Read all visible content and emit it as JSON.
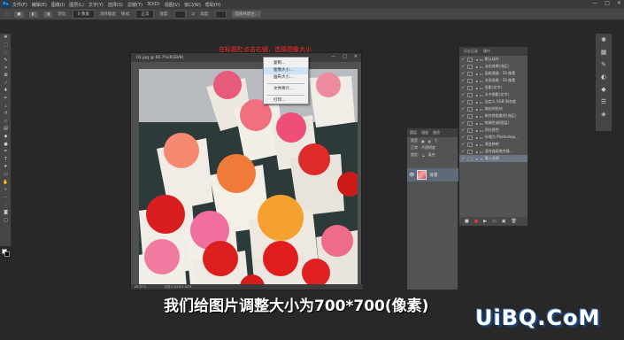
{
  "app": {
    "logo": "Ps"
  },
  "menubar": {
    "items": [
      "文件(F)",
      "编辑(E)",
      "图像(I)",
      "图层(L)",
      "文字(Y)",
      "选择(S)",
      "滤镜(T)",
      "3D(D)",
      "视图(V)",
      "窗口(W)",
      "帮助(H)"
    ]
  },
  "window_controls": {
    "minimize": "—",
    "maximize": "□",
    "close": "✕"
  },
  "options_bar": {
    "feather_label": "羽化:",
    "feather_value": "0 像素",
    "antialias": "消除锯齿",
    "style_label": "样式:",
    "style_value": "正常",
    "width_label": "宽度:",
    "height_label": "高度:",
    "select_mask": "选择并遮住..."
  },
  "document": {
    "title": "01.jpg @ 66.7%(RGB/8)",
    "zoom": "66.67%",
    "docinfo": "文档:1.82M/1.82M"
  },
  "context_menu": {
    "items": [
      "复制...",
      "图像大小...",
      "画布大小...",
      "文件简介...",
      "打印..."
    ]
  },
  "caption": {
    "text": "在标题栏点击右键，选择图像大小"
  },
  "layers_panel": {
    "tabs": [
      "图层",
      "通道",
      "路径"
    ],
    "filter": "类型",
    "mode": "正常",
    "opacity": "不透明度",
    "lock": "锁定:",
    "fill": "填充",
    "layer_name": "背景"
  },
  "history_panel": {
    "tabs": [
      "历史记录",
      "操作"
    ],
    "items": [
      {
        "label": "默认动作",
        "expand": "▾"
      },
      {
        "label": "淡出效果(选区)",
        "expand": "▸"
      },
      {
        "label": "画框通道 - 50 像素",
        "expand": "▸"
      },
      {
        "label": "木质画框 - 50 像素",
        "expand": "▸"
      },
      {
        "label": "投影(文字)",
        "expand": "▸"
      },
      {
        "label": "水中倒影(文字)",
        "expand": "▸"
      },
      {
        "label": "自定义 RGB 到灰度",
        "expand": "▸"
      },
      {
        "label": "熔化的铅块",
        "expand": "▸"
      },
      {
        "label": "制作剪贴路径(选区)",
        "expand": "▸"
      },
      {
        "label": "棕褐色调(图层)",
        "expand": "▸"
      },
      {
        "label": "四分颜色",
        "expand": "▸"
      },
      {
        "label": "存储为 Photoshop...",
        "expand": "▸"
      },
      {
        "label": "渐变映射",
        "expand": "▸"
      },
      {
        "label": "混合器画笔克隆...",
        "expand": "▸"
      },
      {
        "label": "载入选择",
        "expand": "▸"
      }
    ],
    "selected_index": 14,
    "footer_icons": [
      "stop-icon",
      "record-icon",
      "play-icon",
      "folder-icon",
      "new-icon",
      "delete-icon"
    ]
  },
  "subtitle": {
    "text": "我们给图片调整大小为700*700(像素)"
  },
  "watermark": {
    "text": "UiBQ.CoM"
  },
  "colors": {
    "caption_red": "#ff2a2a",
    "panel_bg": "#535353",
    "workspace_bg": "#282828",
    "menu_highlight": "#cfe2f5"
  }
}
